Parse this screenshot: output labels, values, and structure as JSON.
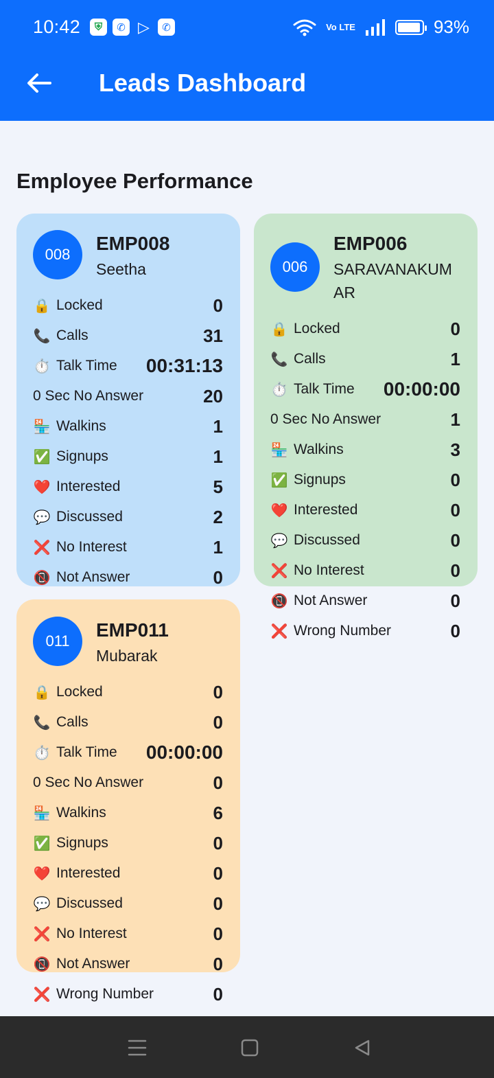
{
  "status_bar": {
    "time": "10:42",
    "network_label": "Vo LTE",
    "battery_level": 0.93,
    "battery_text": "93%"
  },
  "app_bar": {
    "title": "Leads Dashboard"
  },
  "section_title": "Employee Performance",
  "employees": [
    {
      "code_short": "008",
      "code": "EMP008",
      "name": "Seetha",
      "metrics": [
        {
          "icon": "lock",
          "emoji": "🔒",
          "label": "Locked",
          "value": "0"
        },
        {
          "icon": "phone",
          "emoji": "📞",
          "label": "Calls",
          "value": "31"
        },
        {
          "icon": "stopwatch",
          "emoji": "⏱️",
          "label": "Talk Time",
          "value": "00:31:13"
        },
        {
          "icon": "",
          "emoji": "",
          "label": "0 Sec No Answer",
          "value": "20"
        },
        {
          "icon": "store",
          "emoji": "🏪",
          "label": "Walkins",
          "value": "1"
        },
        {
          "icon": "check",
          "emoji": "✅",
          "label": "Signups",
          "value": "1"
        },
        {
          "icon": "heart",
          "emoji": "❤️",
          "label": "Interested",
          "value": "5"
        },
        {
          "icon": "speech",
          "emoji": "💬",
          "label": "Discussed",
          "value": "2"
        },
        {
          "icon": "cross",
          "emoji": "❌",
          "label": "No Interest",
          "value": "1"
        },
        {
          "icon": "no-phone",
          "emoji": "📵",
          "label": "Not Answer",
          "value": "0"
        }
      ]
    },
    {
      "code_short": "006",
      "code": "EMP006",
      "name_line1": "SARAVANAKUM",
      "name_line2": "AR",
      "metrics": [
        {
          "icon": "lock",
          "emoji": "🔒",
          "label": "Locked",
          "value": "0"
        },
        {
          "icon": "phone",
          "emoji": "📞",
          "label": "Calls",
          "value": "1"
        },
        {
          "icon": "stopwatch",
          "emoji": "⏱️",
          "label": "Talk Time",
          "value": "00:00:00"
        },
        {
          "icon": "",
          "emoji": "",
          "label": "0 Sec No Answer",
          "value": "1"
        },
        {
          "icon": "store",
          "emoji": "🏪",
          "label": "Walkins",
          "value": "3"
        },
        {
          "icon": "check",
          "emoji": "✅",
          "label": "Signups",
          "value": "0"
        },
        {
          "icon": "heart",
          "emoji": "❤️",
          "label": "Interested",
          "value": "0"
        },
        {
          "icon": "speech",
          "emoji": "💬",
          "label": "Discussed",
          "value": "0"
        },
        {
          "icon": "cross",
          "emoji": "❌",
          "label": "No Interest",
          "value": "0"
        },
        {
          "icon": "no-phone",
          "emoji": "📵",
          "label": "Not Answer",
          "value": "0"
        },
        {
          "icon": "cross",
          "emoji": "❌",
          "label": "Wrong Number",
          "value": "0"
        }
      ]
    },
    {
      "code_short": "011",
      "code": "EMP011",
      "name": "Mubarak",
      "metrics": [
        {
          "icon": "lock",
          "emoji": "🔒",
          "label": "Locked",
          "value": "0"
        },
        {
          "icon": "phone",
          "emoji": "📞",
          "label": "Calls",
          "value": "0"
        },
        {
          "icon": "stopwatch",
          "emoji": "⏱️",
          "label": "Talk Time",
          "value": "00:00:00"
        },
        {
          "icon": "",
          "emoji": "",
          "label": "0 Sec No Answer",
          "value": "0"
        },
        {
          "icon": "store",
          "emoji": "🏪",
          "label": "Walkins",
          "value": "6"
        },
        {
          "icon": "check",
          "emoji": "✅",
          "label": "Signups",
          "value": "0"
        },
        {
          "icon": "heart",
          "emoji": "❤️",
          "label": "Interested",
          "value": "0"
        },
        {
          "icon": "speech",
          "emoji": "💬",
          "label": "Discussed",
          "value": "0"
        },
        {
          "icon": "cross",
          "emoji": "❌",
          "label": "No Interest",
          "value": "0"
        },
        {
          "icon": "no-phone",
          "emoji": "📵",
          "label": "Not Answer",
          "value": "0"
        },
        {
          "icon": "cross",
          "emoji": "❌",
          "label": "Wrong Number",
          "value": "0"
        }
      ]
    }
  ],
  "colors": {
    "primary": "#0d6efd",
    "card_blue": "#bfdffa",
    "card_green": "#c9e6cd",
    "card_orange": "#fde0b6",
    "background": "#f1f4fb",
    "nav_bar": "#2b2b2b"
  }
}
